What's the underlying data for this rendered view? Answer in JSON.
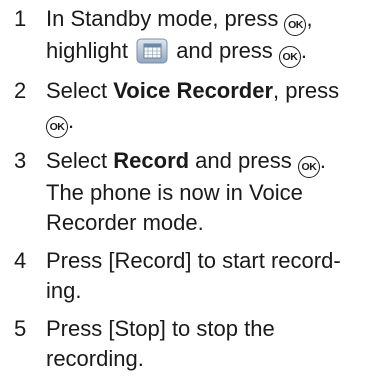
{
  "ok_key_label": "OK",
  "icon": "organizer-menu-icon",
  "steps": [
    {
      "num": "1",
      "l1_a": "In Standby mode, press ",
      "l1_b": ",",
      "l2_a": "highlight ",
      "l2_b": " and press ",
      "l2_c": "."
    },
    {
      "num": "2",
      "a": "Select ",
      "bold": "Voice Recorder",
      "b": ", press",
      "c": "."
    },
    {
      "num": "3",
      "a": "Select ",
      "bold": "Record",
      "b": " and press ",
      "c": ".",
      "l2": "The phone is now in Voice",
      "l3": "Recorder mode."
    },
    {
      "num": "4",
      "l1": "Press [Record] to start record-",
      "l2": "ing."
    },
    {
      "num": "5",
      "l1": "Press [Stop] to stop the",
      "l2": "recording."
    }
  ]
}
